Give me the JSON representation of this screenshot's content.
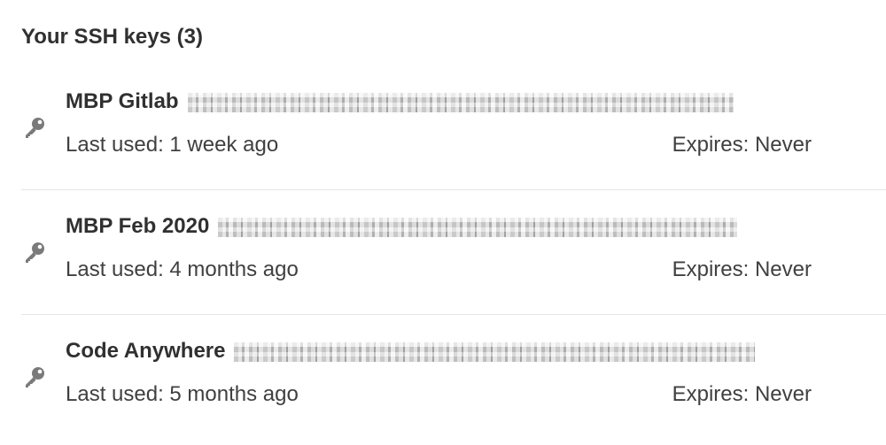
{
  "ssh_keys": {
    "heading": "Your SSH keys (3)",
    "items": [
      {
        "title": "MBP Gitlab",
        "last_used": "Last used: 1 week ago",
        "expires": "Expires: Never"
      },
      {
        "title": "MBP Feb 2020",
        "last_used": "Last used: 4 months ago",
        "expires": "Expires: Never"
      },
      {
        "title": "Code Anywhere",
        "last_used": "Last used: 5 months ago",
        "expires": "Expires: Never"
      }
    ]
  },
  "icons": {
    "key_icon": "key-icon"
  },
  "colors": {
    "text_primary": "#303030",
    "text_secondary": "#404040",
    "divider": "#e5e5e5",
    "icon": "#777777"
  }
}
